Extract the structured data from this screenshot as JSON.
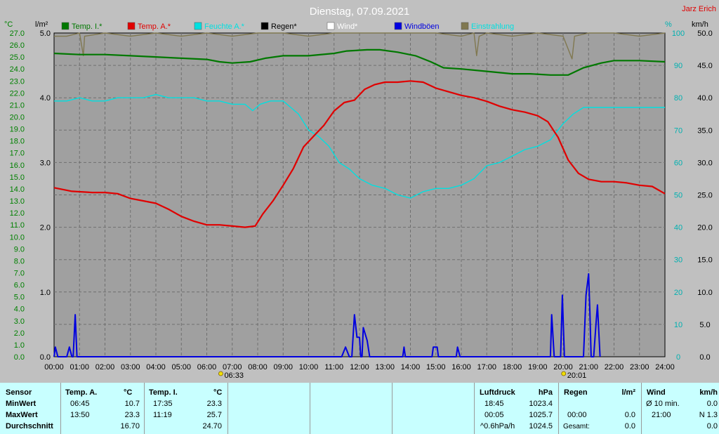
{
  "page_title": "Dienstag, 07.09.2021",
  "author": "Jarz Erich",
  "colors": {
    "temp_inside": "#007800",
    "temp_outside": "#e00000",
    "humidity": "#00e0e0",
    "rain": "#000000",
    "wind": "#ffffff",
    "gusts": "#0000e0",
    "radiation": "#807850",
    "plot_bg": "#a0a0a0",
    "page_bg": "#c0c0c0",
    "axis_temp": "#008000",
    "axis_hum": "#00b0b0"
  },
  "chart_data": {
    "type": "line",
    "title": "Dienstag, 07.09.2021",
    "axes": {
      "temp": {
        "unit": "°C",
        "range": [
          0,
          27
        ],
        "step": 1
      },
      "rain": {
        "unit": "l/m²",
        "range": [
          0,
          5
        ],
        "step": 1
      },
      "humidity": {
        "unit": "%",
        "range": [
          0,
          100
        ],
        "step": 10
      },
      "wind": {
        "unit": "km/h",
        "range": [
          0,
          50
        ],
        "step": 5
      }
    },
    "x_ticks": [
      "00:00",
      "01:00",
      "02:00",
      "03:00",
      "04:00",
      "05:00",
      "06:00",
      "07:00",
      "08:00",
      "09:00",
      "10:00",
      "11:00",
      "12:00",
      "13:00",
      "14:00",
      "15:00",
      "16:00",
      "17:00",
      "18:00",
      "19:00",
      "20:00",
      "21:00",
      "22:00",
      "23:00",
      "24:00"
    ],
    "sunrise": {
      "label": "06:33",
      "hour": 6.55
    },
    "sunset": {
      "label": "20:01",
      "hour": 20.02
    },
    "grid": true,
    "legend_position": "top",
    "series": [
      {
        "name": "Temp. I.*",
        "key": "temp_inside",
        "axis": "temp",
        "points": [
          [
            0,
            25.3
          ],
          [
            1,
            25.2
          ],
          [
            2,
            25.2
          ],
          [
            3,
            25.1
          ],
          [
            4,
            25.0
          ],
          [
            5,
            24.9
          ],
          [
            6,
            24.8
          ],
          [
            6.5,
            24.6
          ],
          [
            7,
            24.5
          ],
          [
            7.7,
            24.6
          ],
          [
            8.3,
            24.9
          ],
          [
            9,
            25.1
          ],
          [
            10,
            25.1
          ],
          [
            11,
            25.3
          ],
          [
            11.5,
            25.5
          ],
          [
            12.3,
            25.6
          ],
          [
            12.8,
            25.6
          ],
          [
            13.5,
            25.4
          ],
          [
            14.2,
            25.1
          ],
          [
            14.8,
            24.6
          ],
          [
            15.3,
            24.1
          ],
          [
            16,
            24.0
          ],
          [
            17,
            23.8
          ],
          [
            18,
            23.6
          ],
          [
            18.7,
            23.6
          ],
          [
            19.5,
            23.5
          ],
          [
            20.2,
            23.5
          ],
          [
            20.8,
            24.1
          ],
          [
            21.5,
            24.5
          ],
          [
            22,
            24.7
          ],
          [
            23,
            24.7
          ],
          [
            24,
            24.6
          ]
        ]
      },
      {
        "name": "Temp. A.*",
        "key": "temp_outside",
        "axis": "temp",
        "points": [
          [
            0,
            14.1
          ],
          [
            0.7,
            13.8
          ],
          [
            1.5,
            13.7
          ],
          [
            2,
            13.7
          ],
          [
            2.5,
            13.6
          ],
          [
            3,
            13.2
          ],
          [
            3.5,
            13.0
          ],
          [
            4,
            12.8
          ],
          [
            4.5,
            12.3
          ],
          [
            5,
            11.7
          ],
          [
            5.5,
            11.3
          ],
          [
            6,
            11.0
          ],
          [
            6.5,
            11.0
          ],
          [
            7,
            10.9
          ],
          [
            7.5,
            10.8
          ],
          [
            7.9,
            10.9
          ],
          [
            8.2,
            11.9
          ],
          [
            8.6,
            13.0
          ],
          [
            9,
            14.3
          ],
          [
            9.4,
            15.7
          ],
          [
            9.8,
            17.5
          ],
          [
            10.2,
            18.4
          ],
          [
            10.6,
            19.3
          ],
          [
            11,
            20.5
          ],
          [
            11.4,
            21.2
          ],
          [
            11.8,
            21.4
          ],
          [
            12.2,
            22.3
          ],
          [
            12.6,
            22.7
          ],
          [
            13,
            22.9
          ],
          [
            13.5,
            22.9
          ],
          [
            14,
            23.0
          ],
          [
            14.5,
            22.9
          ],
          [
            15,
            22.4
          ],
          [
            15.5,
            22.1
          ],
          [
            16,
            21.8
          ],
          [
            16.5,
            21.6
          ],
          [
            17,
            21.3
          ],
          [
            17.5,
            20.9
          ],
          [
            18,
            20.6
          ],
          [
            18.5,
            20.4
          ],
          [
            19,
            20.1
          ],
          [
            19.4,
            19.6
          ],
          [
            19.8,
            18.3
          ],
          [
            20.2,
            16.4
          ],
          [
            20.6,
            15.3
          ],
          [
            21,
            14.8
          ],
          [
            21.5,
            14.6
          ],
          [
            22,
            14.6
          ],
          [
            22.5,
            14.5
          ],
          [
            23,
            14.3
          ],
          [
            23.5,
            14.2
          ],
          [
            24,
            13.6
          ]
        ]
      },
      {
        "name": "Feuchte A.*",
        "key": "humidity",
        "axis": "humidity",
        "points": [
          [
            0,
            79
          ],
          [
            0.5,
            79
          ],
          [
            1,
            80
          ],
          [
            1.5,
            79
          ],
          [
            2,
            79
          ],
          [
            2.5,
            80
          ],
          [
            3,
            80
          ],
          [
            3.5,
            80
          ],
          [
            4,
            81
          ],
          [
            4.5,
            80
          ],
          [
            5,
            80
          ],
          [
            5.5,
            80
          ],
          [
            6,
            79
          ],
          [
            6.5,
            79
          ],
          [
            7,
            78
          ],
          [
            7.5,
            78
          ],
          [
            7.8,
            76
          ],
          [
            8.1,
            78
          ],
          [
            8.5,
            79
          ],
          [
            9,
            79
          ],
          [
            9.3,
            77
          ],
          [
            9.6,
            75
          ],
          [
            10,
            70
          ],
          [
            10.4,
            68
          ],
          [
            10.8,
            65
          ],
          [
            11.2,
            60
          ],
          [
            11.6,
            58
          ],
          [
            12,
            55
          ],
          [
            12.5,
            53
          ],
          [
            13,
            52
          ],
          [
            13.5,
            50
          ],
          [
            14,
            49
          ],
          [
            14.5,
            51
          ],
          [
            15,
            52
          ],
          [
            15.5,
            52
          ],
          [
            16,
            53
          ],
          [
            16.5,
            55
          ],
          [
            17,
            59
          ],
          [
            17.5,
            60
          ],
          [
            18,
            62
          ],
          [
            18.5,
            64
          ],
          [
            19,
            65
          ],
          [
            19.5,
            67
          ],
          [
            20,
            72
          ],
          [
            20.4,
            75
          ],
          [
            20.8,
            77
          ],
          [
            21.2,
            77
          ],
          [
            22,
            77
          ],
          [
            22.5,
            77
          ],
          [
            23,
            77
          ],
          [
            23.5,
            77
          ],
          [
            24,
            77
          ]
        ]
      },
      {
        "name": "Regen*",
        "key": "rain",
        "axis": "rain",
        "points": []
      },
      {
        "name": "Wind*",
        "key": "wind",
        "axis": "wind",
        "points": []
      },
      {
        "name": "Windböen",
        "key": "gusts",
        "axis": "wind",
        "points": [
          [
            0,
            0
          ],
          [
            0.05,
            1.5
          ],
          [
            0.15,
            0
          ],
          [
            0.5,
            0
          ],
          [
            0.6,
            1.5
          ],
          [
            0.7,
            0
          ],
          [
            0.75,
            0
          ],
          [
            0.83,
            6.5
          ],
          [
            0.9,
            0
          ],
          [
            11.3,
            0
          ],
          [
            11.45,
            1.5
          ],
          [
            11.6,
            0
          ],
          [
            11.7,
            0
          ],
          [
            11.8,
            6.5
          ],
          [
            11.9,
            3
          ],
          [
            12,
            3
          ],
          [
            12.05,
            0
          ],
          [
            12.1,
            0
          ],
          [
            12.15,
            4.5
          ],
          [
            12.3,
            2.5
          ],
          [
            12.4,
            0
          ],
          [
            13.7,
            0
          ],
          [
            13.75,
            1.5
          ],
          [
            13.8,
            0
          ],
          [
            14.85,
            0
          ],
          [
            14.9,
            1.5
          ],
          [
            15.05,
            1.5
          ],
          [
            15.1,
            0
          ],
          [
            15.8,
            0
          ],
          [
            15.85,
            1.5
          ],
          [
            15.95,
            0
          ],
          [
            19.5,
            0
          ],
          [
            19.55,
            6.5
          ],
          [
            19.65,
            0
          ],
          [
            19.9,
            0
          ],
          [
            19.97,
            9.5
          ],
          [
            20.05,
            0
          ],
          [
            20.8,
            0
          ],
          [
            20.9,
            9.5
          ],
          [
            21,
            12.8
          ],
          [
            21.05,
            7
          ],
          [
            21.1,
            0
          ],
          [
            21.2,
            0
          ],
          [
            21.3,
            5.5
          ],
          [
            21.35,
            8
          ],
          [
            21.45,
            0
          ]
        ]
      },
      {
        "name": "Einstrahlung",
        "key": "radiation",
        "axis": "humidity",
        "points": [
          [
            0,
            99
          ],
          [
            0.5,
            99
          ],
          [
            1,
            100
          ],
          [
            1.15,
            93
          ],
          [
            1.2,
            99
          ],
          [
            2,
            100
          ],
          [
            3,
            99
          ],
          [
            4,
            100
          ],
          [
            5,
            99
          ],
          [
            6,
            100
          ],
          [
            7,
            99
          ],
          [
            8,
            100
          ],
          [
            9,
            100
          ],
          [
            10,
            99
          ],
          [
            11,
            100
          ],
          [
            12,
            100
          ],
          [
            13,
            100
          ],
          [
            14,
            100
          ],
          [
            15,
            100
          ],
          [
            16,
            99
          ],
          [
            16.5,
            100
          ],
          [
            16.6,
            93
          ],
          [
            16.7,
            99
          ],
          [
            17,
            100
          ],
          [
            18,
            99
          ],
          [
            19,
            100
          ],
          [
            20,
            99
          ],
          [
            20.35,
            92
          ],
          [
            20.45,
            99
          ],
          [
            21,
            100
          ],
          [
            22,
            100
          ],
          [
            23,
            99
          ],
          [
            24,
            100
          ]
        ]
      }
    ]
  },
  "summary": {
    "sensor": {
      "title": "Sensor",
      "rows": [
        "MinWert",
        "MaxWert",
        "Durchschnitt"
      ]
    },
    "temp_a": {
      "title": "Temp. A.",
      "unit": "°C",
      "min_time": "06:45",
      "min_val": "10.7",
      "max_time": "13:50",
      "max_val": "23.3",
      "avg": "16.70"
    },
    "temp_i": {
      "title": "Temp. I.",
      "unit": "°C",
      "min_time": "17:35",
      "min_val": "23.3",
      "max_time": "11:19",
      "max_val": "25.7",
      "avg": "24.70"
    },
    "pressure": {
      "title": "Luftdruck",
      "unit": "hPa",
      "min_time": "18:45",
      "min_val": "1023.4",
      "max_time": "00:05",
      "max_val": "1025.7",
      "trend": "^0.6hPa/h",
      "avg": "1024.5"
    },
    "rain": {
      "title": "Regen",
      "unit": "l/m²",
      "max_time": "00:00",
      "max_val": "0.0",
      "total_label": "Gesamt:",
      "total": "0.0"
    },
    "wind": {
      "title": "Wind",
      "unit": "km/h",
      "avg_label": "Ø 10 min.",
      "avg_val": "0.0",
      "dir_time": "21:00",
      "dir_val": "N 1.3",
      "extra": "0.0"
    }
  }
}
